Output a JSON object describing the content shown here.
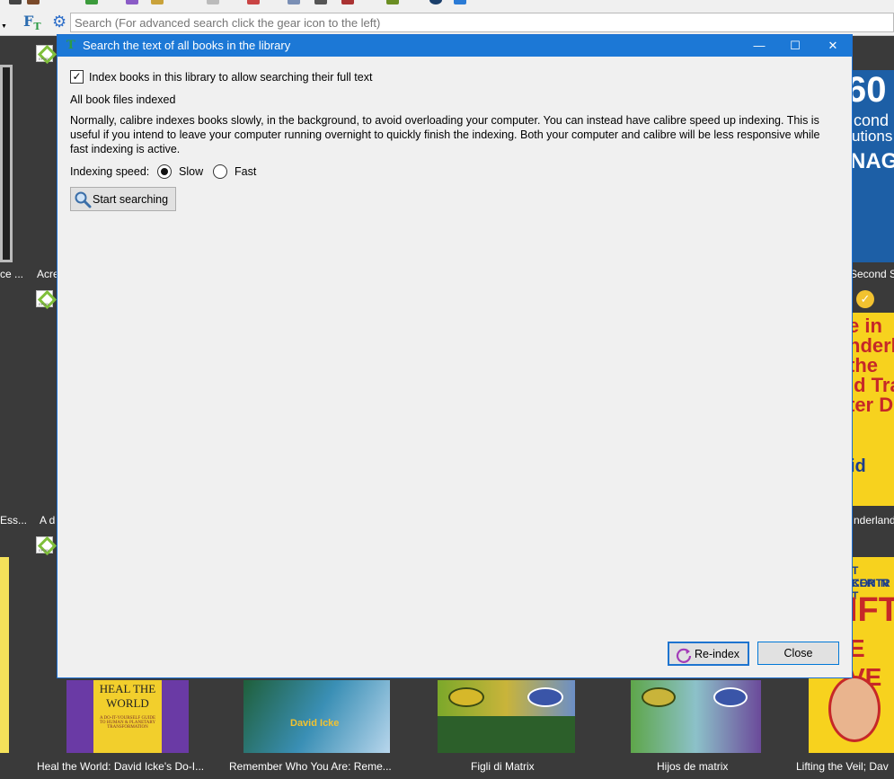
{
  "search": {
    "placeholder": "Search (For advanced search click the gear icon to the left)",
    "ft_label": "F",
    "ft_sub": "T"
  },
  "background_titles": {
    "row1": [
      "ce ...",
      "Acre",
      "Second S"
    ],
    "row2": [
      "Ess...",
      "A d",
      "nderland"
    ],
    "row3": [
      "Heal the World: David Icke's Do-I...",
      "Remember Who You Are: Reme...",
      "Figli di Matrix",
      "Hijos de matrix",
      "Lifting the Veil; Dav"
    ]
  },
  "cover_text": {
    "heal": [
      "HEAL THE",
      "WORLD",
      "A DO-IT-YOURSELF GUIDE",
      "TO HUMAN & PLANETARY",
      "TRANSFORMATION"
    ],
    "remember": [
      "David Icke"
    ],
    "second_right": [
      "60",
      "cond",
      "utions",
      "NAGE"
    ],
    "wonder_right": [
      "e in",
      "nderla",
      "the",
      "ld Tra",
      "ter Di",
      "id"
    ],
    "lifting_right": [
      "T CONTR",
      "KER IN T",
      "IFT",
      "E VE"
    ]
  },
  "dialog": {
    "title": "Search the text of all books in the library",
    "app_icon": "T",
    "minimize": "—",
    "maximize": "☐",
    "close": "✕",
    "checkbox_label": "Index books in this library to allow searching their full text",
    "checkbox_checked": "✓",
    "status": "All book files indexed",
    "description": "Normally, calibre indexes books slowly, in the background, to avoid overloading your computer. You can instead have calibre speed up indexing. This is useful if you intend to leave your computer running overnight to quickly finish the indexing. Both your computer and calibre will be less responsive while fast indexing is active.",
    "speed_label": "Indexing speed:",
    "speed_options": [
      "Slow",
      "Fast"
    ],
    "speed_selected": "Slow",
    "start_button": "Start searching",
    "reindex_button": "Re-index",
    "close_button": "Close"
  }
}
